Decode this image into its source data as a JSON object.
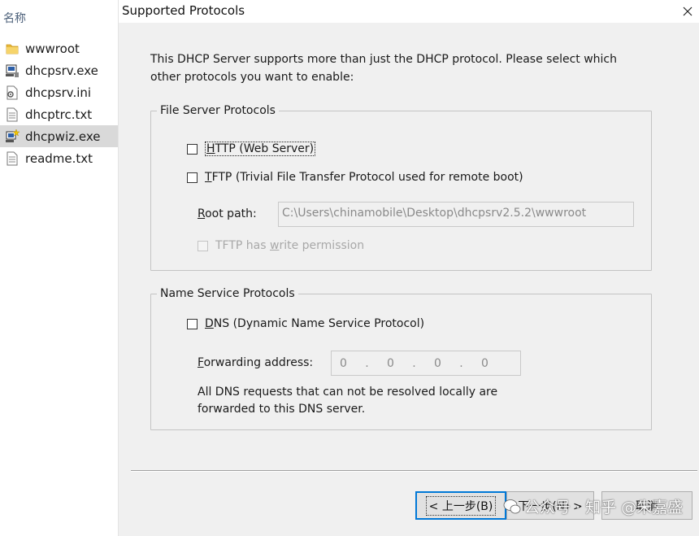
{
  "explorer": {
    "column_header": "名称",
    "files": [
      {
        "name": "wwwroot",
        "icon": "folder-icon"
      },
      {
        "name": "dhcpsrv.exe",
        "icon": "application-icon"
      },
      {
        "name": "dhcpsrv.ini",
        "icon": "config-file-icon"
      },
      {
        "name": "dhcptrc.txt",
        "icon": "text-file-icon"
      },
      {
        "name": "dhcpwiz.exe",
        "icon": "wizard-application-icon",
        "selected": true
      },
      {
        "name": "readme.txt",
        "icon": "text-file-icon"
      }
    ]
  },
  "dialog": {
    "title": "Supported Protocols",
    "intro_line1": "This DHCP Server supports more than just the DHCP protocol. Please select which",
    "intro_line2": "other protocols you want to enable:",
    "file_server_group": {
      "legend": "File Server Protocols",
      "http_label": "HTTP (Web Server)",
      "http_accel": "H",
      "http_rest": "TTP (Web Server)",
      "tftp_accel": "T",
      "tftp_rest": "FTP (Trivial File Transfer Protocol used for remote boot)",
      "root_path_accel": "R",
      "root_path_rest": "oot path:",
      "root_path_value": "C:\\Users\\chinamobile\\Desktop\\dhcpsrv2.5.2\\wwwroot",
      "write_perm_pre": "TFTP has ",
      "write_perm_accel": "w",
      "write_perm_post": "rite permission"
    },
    "name_service_group": {
      "legend": "Name Service Protocols",
      "dns_accel": "D",
      "dns_rest": "NS (Dynamic Name Service Protocol)",
      "fwd_accel": "F",
      "fwd_rest": "orwarding address:",
      "fwd_octets": [
        "0",
        "0",
        "0",
        "0"
      ],
      "note_line1": "All DNS requests that can not be resolved locally are",
      "note_line2": "forwarded to this DNS server."
    },
    "buttons": {
      "back": "< 上一步(B)",
      "next": "下一步(N) >",
      "cancel": "取消"
    }
  },
  "watermark": {
    "text": "公众号 · 知乎 @朱嘉盛"
  }
}
